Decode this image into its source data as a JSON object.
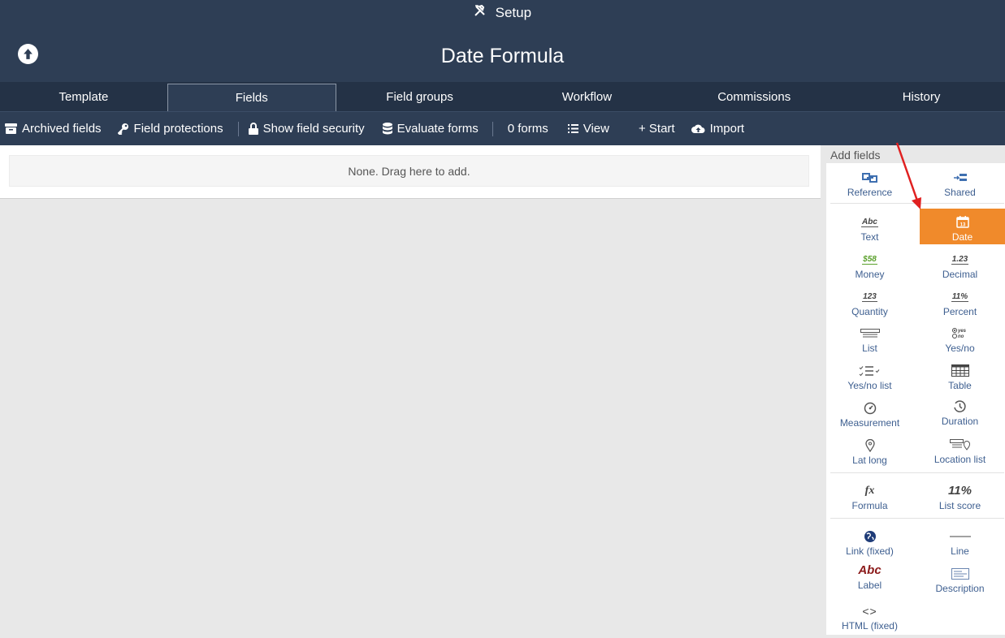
{
  "header": {
    "setup_label": "Setup",
    "title": "Date Formula"
  },
  "tabs": [
    {
      "label": "Template"
    },
    {
      "label": "Fields"
    },
    {
      "label": "Field groups"
    },
    {
      "label": "Workflow"
    },
    {
      "label": "Commissions"
    },
    {
      "label": "History"
    }
  ],
  "toolbar": {
    "archived_fields": "Archived fields",
    "field_protections": "Field protections",
    "show_field_security": "Show field security",
    "evaluate_forms": "Evaluate forms",
    "forms_count": "0 forms",
    "view": "View",
    "start": "+ Start",
    "import": "Import"
  },
  "main": {
    "drop_zone_text": "None. Drag here to add."
  },
  "add_fields": {
    "title": "Add fields",
    "items": [
      {
        "label": "Reference",
        "icon": "reference-icon"
      },
      {
        "label": "Shared",
        "icon": "shared-icon"
      },
      {
        "label": "Text",
        "icon": "text-icon",
        "icon_text": "Abc"
      },
      {
        "label": "Date",
        "icon": "calendar-icon",
        "icon_text": "13"
      },
      {
        "label": "Money",
        "icon": "money-icon",
        "icon_text": "$58"
      },
      {
        "label": "Decimal",
        "icon": "decimal-icon",
        "icon_text": "1.23"
      },
      {
        "label": "Quantity",
        "icon": "quantity-icon",
        "icon_text": "123"
      },
      {
        "label": "Percent",
        "icon": "percent-icon",
        "icon_text": "11%"
      },
      {
        "label": "List",
        "icon": "list-icon"
      },
      {
        "label": "Yes/no",
        "icon": "yes-no-icon",
        "icon_text_1": "yes",
        "icon_text_2": "no"
      },
      {
        "label": "Yes/no list",
        "icon": "yes-no-list-icon"
      },
      {
        "label": "Table",
        "icon": "table-icon"
      },
      {
        "label": "Measurement",
        "icon": "gauge-icon"
      },
      {
        "label": "Duration",
        "icon": "duration-icon"
      },
      {
        "label": "Lat long",
        "icon": "location-pin-icon"
      },
      {
        "label": "Location list",
        "icon": "location-list-icon"
      },
      {
        "label": "Formula",
        "icon": "formula-icon",
        "icon_text": "fx"
      },
      {
        "label": "List score",
        "icon": "list-score-icon",
        "icon_text": "11%"
      },
      {
        "label": "Link (fixed)",
        "icon": "globe-link-icon"
      },
      {
        "label": "Line",
        "icon": "line-icon"
      },
      {
        "label": "Label",
        "icon": "label-icon",
        "icon_text": "Abc"
      },
      {
        "label": "Description",
        "icon": "description-icon"
      },
      {
        "label": "HTML (fixed)",
        "icon": "html-code-icon",
        "icon_text": "<>"
      }
    ]
  },
  "colors": {
    "header_bg": "#2e3e55",
    "tabs_bg": "#243246",
    "accent": "#f08a2b",
    "link_text": "#3e5f90",
    "annotation_arrow": "#e02020"
  }
}
